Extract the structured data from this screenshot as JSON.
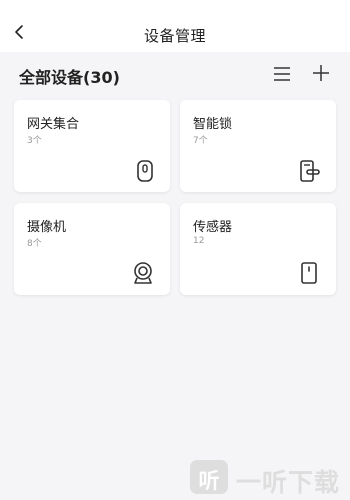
{
  "header": {
    "title": "设备管理",
    "back_icon": "chevron-left-icon"
  },
  "section": {
    "title": "全部设备(30)",
    "list_icon": "list-icon",
    "add_icon": "plus-icon"
  },
  "devices": [
    {
      "name": "网关集合",
      "count": "3个",
      "icon": "gateway-icon"
    },
    {
      "name": "智能锁",
      "count": "7个",
      "icon": "smart-lock-icon"
    },
    {
      "name": "摄像机",
      "count": "8个",
      "icon": "camera-icon"
    },
    {
      "name": "传感器",
      "count": "12",
      "icon": "sensor-icon"
    }
  ],
  "watermark": {
    "logo_text": "听",
    "text": "一听下载"
  },
  "colors": {
    "background": "#f5f5f7",
    "card": "#ffffff",
    "icon_stroke": "#333333",
    "watermark": "#dcdcdc"
  }
}
